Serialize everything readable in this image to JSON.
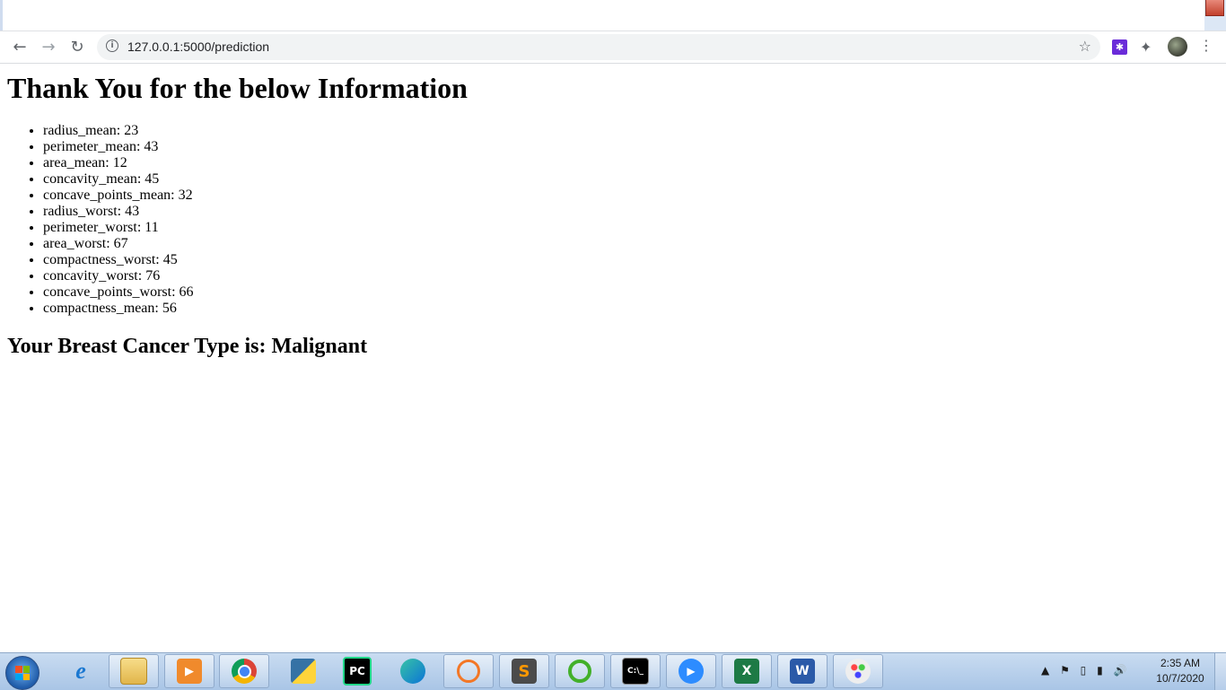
{
  "browser": {
    "url": "127.0.0.1:5000/prediction"
  },
  "page": {
    "heading": "Thank You for the below Information",
    "items": [
      {
        "label": "radius_mean: 23"
      },
      {
        "label": "perimeter_mean: 43"
      },
      {
        "label": "area_mean: 12"
      },
      {
        "label": "concavity_mean: 45"
      },
      {
        "label": "concave_points_mean: 32"
      },
      {
        "label": "radius_worst: 43"
      },
      {
        "label": "perimeter_worst: 11"
      },
      {
        "label": "area_worst: 67"
      },
      {
        "label": "compactness_worst: 45"
      },
      {
        "label": "concavity_worst: 76"
      },
      {
        "label": "concave_points_worst: 66"
      },
      {
        "label": "compactness_mean: 56"
      }
    ],
    "result": "Your Breast Cancer Type is: Malignant"
  },
  "taskbar": {
    "clock_time": "2:35 AM",
    "clock_date": "10/7/2020",
    "pinned": [
      {
        "name": "internet-explorer-icon"
      },
      {
        "name": "file-explorer-icon"
      },
      {
        "name": "media-player-icon"
      },
      {
        "name": "chrome-icon"
      },
      {
        "name": "python-icon"
      },
      {
        "name": "pycharm-icon"
      },
      {
        "name": "edge-icon"
      },
      {
        "name": "jupyter-icon"
      },
      {
        "name": "sublime-text-icon"
      },
      {
        "name": "anaconda-icon"
      },
      {
        "name": "command-prompt-icon"
      },
      {
        "name": "zoom-icon"
      },
      {
        "name": "excel-icon"
      },
      {
        "name": "word-icon"
      },
      {
        "name": "paint-icon"
      }
    ]
  }
}
